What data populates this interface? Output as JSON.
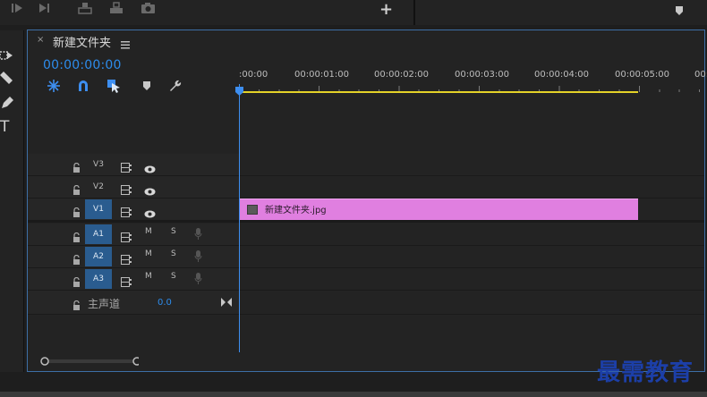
{
  "top": {
    "plus_label": "+"
  },
  "panel": {
    "close_label": "×",
    "title": "新建文件夹",
    "timecode": "00:00:00:00"
  },
  "ruler": {
    "labels": [
      ":00:00",
      "00:00:01:00",
      "00:00:02:00",
      "00:00:03:00",
      "00:00:04:00",
      "00:00:05:00",
      "00:0"
    ]
  },
  "tracks": {
    "video": [
      {
        "name": "V3",
        "selected": false
      },
      {
        "name": "V2",
        "selected": false
      },
      {
        "name": "V1",
        "selected": true
      }
    ],
    "audio": [
      {
        "name": "A1",
        "m": "M",
        "s": "S"
      },
      {
        "name": "A2",
        "m": "M",
        "s": "S"
      },
      {
        "name": "A3",
        "m": "M",
        "s": "S"
      }
    ],
    "master": {
      "label": "主声道",
      "value": "0.0"
    }
  },
  "clip": {
    "name": "新建文件夹.jpg",
    "color": "#e07fe0"
  },
  "watermark": "最需教育",
  "colors": {
    "accent": "#2d8ceb",
    "work_area": "#e4d228",
    "selected_track": "#2a5c8f"
  }
}
